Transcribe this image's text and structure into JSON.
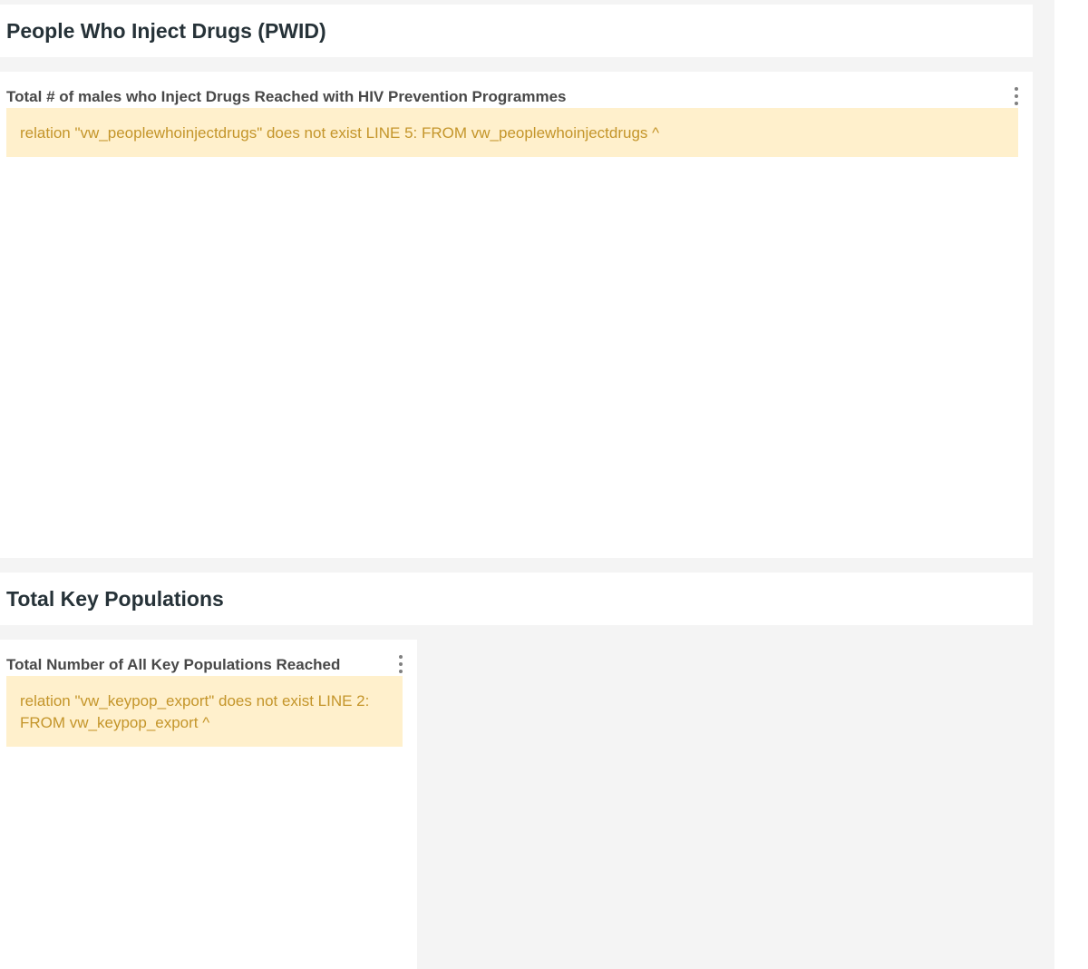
{
  "sections": [
    {
      "title": "People Who Inject Drugs (PWID)",
      "chart": {
        "title": "Total # of males who Inject Drugs Reached with HIV Prevention Programmes",
        "error": "relation \"vw_peoplewhoinjectdrugs\" does not exist LINE 5: FROM vw_peoplewhoinjectdrugs ^",
        "menu_icon": "more-vertical-icon"
      }
    },
    {
      "title": "Total Key Populations",
      "chart": {
        "title": "Total Number of All Key Populations Reached",
        "error": "relation \"vw_keypop_export\" does not exist LINE 2: FROM vw_keypop_export ^",
        "menu_icon": "more-vertical-icon"
      }
    }
  ],
  "colors": {
    "page_background": "#f4f4f4",
    "card_background": "#ffffff",
    "heading_text": "#263238",
    "chart_title_text": "#484848",
    "alert_background": "#fff0cc",
    "alert_text": "#c4952a",
    "icon": "#808080"
  }
}
